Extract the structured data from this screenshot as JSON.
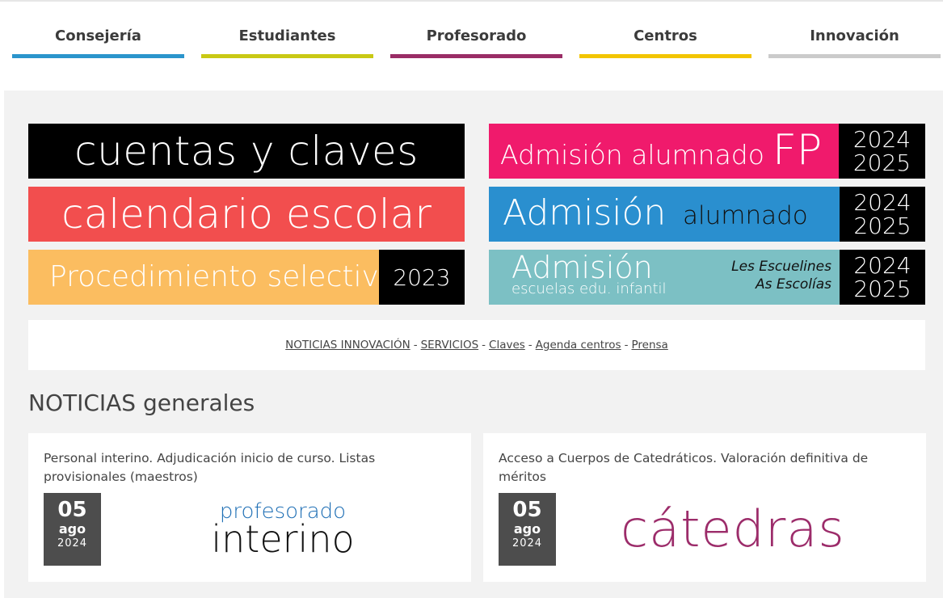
{
  "nav": {
    "items": [
      {
        "label": "Consejería",
        "color": "#2b95cc"
      },
      {
        "label": "Estudiantes",
        "color": "#c9c914"
      },
      {
        "label": "Profesorado",
        "color": "#9a2d66"
      },
      {
        "label": "Centros",
        "color": "#f2c500"
      },
      {
        "label": "Innovación",
        "color": "#cbcbcb"
      }
    ]
  },
  "banners": {
    "cuentas": {
      "text": "cuentas y claves",
      "bg": "#000000"
    },
    "calendario": {
      "text": "calendario escolar",
      "bg": "#f24e4e"
    },
    "procedimiento": {
      "text": "Procedimiento selectivo",
      "year": "2023",
      "bg": "#fbbd60"
    },
    "admision_fp": {
      "text": "Admisión alumnado",
      "fp": "FP",
      "year1": "2024",
      "year2": "2025",
      "bg": "#f01a6c"
    },
    "admision_alumnado": {
      "text1": "Admisión",
      "text2": "alumnado",
      "year1": "2024",
      "year2": "2025",
      "bg": "#2a8fcf"
    },
    "admision_infantil": {
      "text1": "Admisión",
      "text2": "escuelas edu. infantil",
      "text3": "Les Escuelines",
      "text4": "As Escolías",
      "year1": "2024",
      "year2": "2025",
      "bg": "#7cc0c4"
    }
  },
  "links": [
    "NOTICIAS INNOVACIÓN",
    "SERVICIOS",
    "Claves",
    "Agenda centros",
    "Prensa"
  ],
  "links_separator": "-",
  "section_title": "NOTICIAS generales",
  "news": [
    {
      "title": "Personal interino. Adjudicación inicio de curso. Listas provisionales (maestros)",
      "day": "05",
      "month": "ago",
      "year": "2024",
      "logo_line1": "profesorado",
      "logo_line2": "interino"
    },
    {
      "title": "Acceso a Cuerpos de Catedráticos. Valoración definitiva de méritos",
      "day": "05",
      "month": "ago",
      "year": "2024",
      "logo_line1": "cátedras"
    }
  ]
}
